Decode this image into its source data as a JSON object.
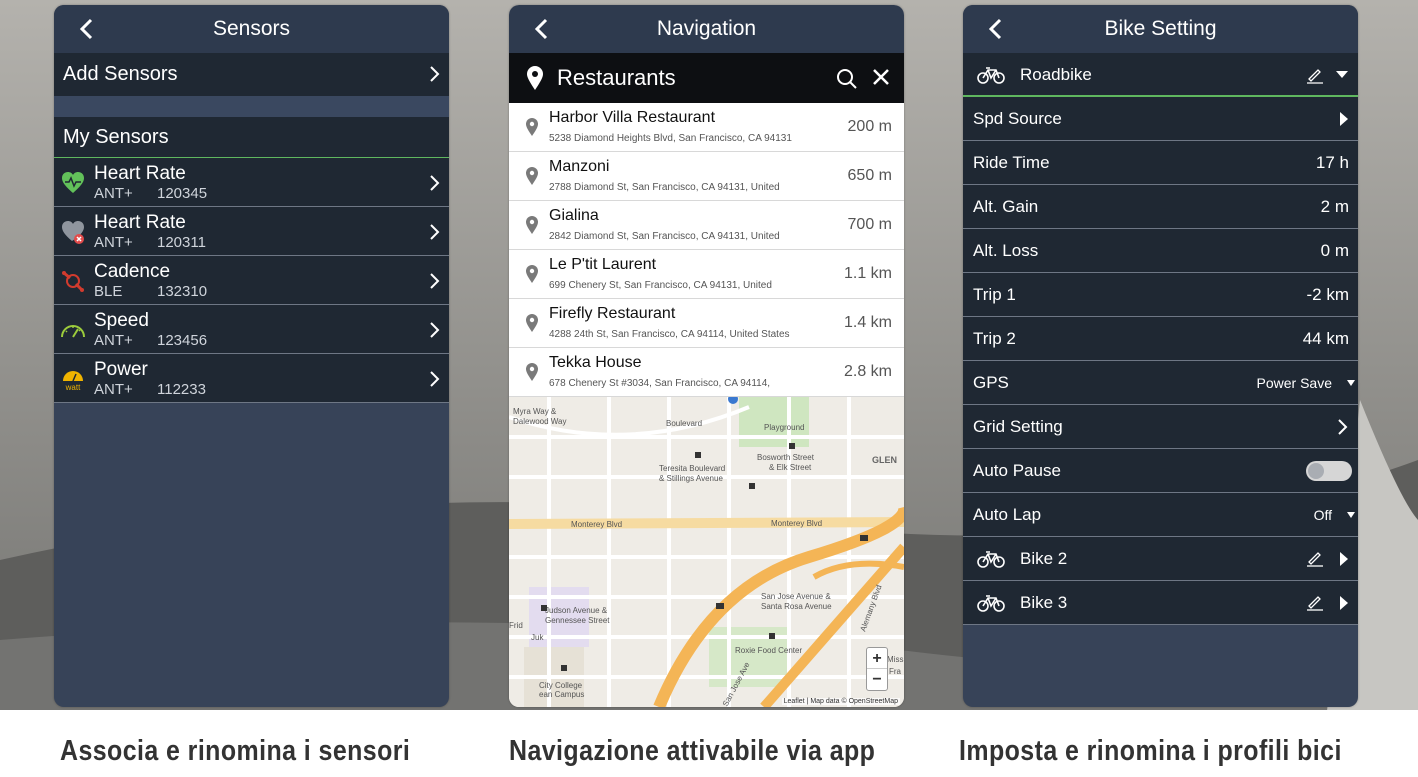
{
  "colors": {
    "panel_bg": "#374358",
    "row_bg": "#1f2833",
    "header_bg": "#2e3a4e",
    "accent_green": "#5fb75f",
    "heart_green": "#62c15a",
    "cadence_red": "#d23b2e",
    "speed_green": "#9ccc3c",
    "power_yellow": "#f0b400",
    "route_orange": "#f4b556"
  },
  "sensors_screen": {
    "title": "Sensors",
    "add_label": "Add Sensors",
    "section_label": "My Sensors",
    "items": [
      {
        "name": "Heart Rate",
        "protocol": "ANT+",
        "id": "120345",
        "icon": "heart-icon"
      },
      {
        "name": "Heart Rate",
        "protocol": "ANT+",
        "id": "120311",
        "icon": "heart-disconnected-icon"
      },
      {
        "name": "Cadence",
        "protocol": "BLE",
        "id": "132310",
        "icon": "cadence-icon"
      },
      {
        "name": "Speed",
        "protocol": "ANT+",
        "id": "123456",
        "icon": "speedometer-icon"
      },
      {
        "name": "Power",
        "protocol": "ANT+",
        "id": "112233",
        "icon": "power-watt-icon"
      }
    ]
  },
  "navigation_screen": {
    "title": "Navigation",
    "search_query": "Restaurants",
    "results": [
      {
        "name": "Harbor Villa Restaurant",
        "address": "5238 Diamond Heights Blvd, San Francisco, CA 94131",
        "distance": "200 m"
      },
      {
        "name": "Manzoni",
        "address": "2788 Diamond St, San Francisco, CA 94131, United",
        "distance": "650 m"
      },
      {
        "name": "Gialina",
        "address": "2842 Diamond St, San Francisco, CA 94131, United",
        "distance": "700 m"
      },
      {
        "name": "Le P'tit Laurent",
        "address": "699 Chenery St, San Francisco, CA 94131, United",
        "distance": "1.1 km"
      },
      {
        "name": "Firefly Restaurant",
        "address": "4288 24th St, San Francisco, CA 94114, United States",
        "distance": "1.4 km"
      },
      {
        "name": "Tekka House",
        "address": "678 Chenery St #3034, San Francisco, CA 94114,",
        "distance": "2.8 km"
      }
    ],
    "map_labels": {
      "myra": "Myra Way &",
      "dalewood": "Dalewood Way",
      "boulevard": "Boulevard",
      "playground": "Playground",
      "teresita": "Teresita Boulevard",
      "stillings": "& Stillings Avenue",
      "bosworth": "Bosworth Street",
      "elk": "& Elk Street",
      "glen": "GLEN",
      "monterey1": "Monterey Blvd",
      "monterey2": "Monterey Blvd",
      "sanjose": "San Jose Avenue &",
      "santarosa": "Santa Rosa Avenue",
      "judson": "Judson Avenue &",
      "gennessee": "Gennessee Street",
      "roxie": "Roxie Food Center",
      "city": "City College",
      "campus": "ean Campus",
      "frid": "Frid",
      "juk": "Juk",
      "missi": "Missi",
      "fra": "Fra",
      "alemany": "Alemany Blvd",
      "san": "San Jose Ave"
    },
    "zoom_in": "+",
    "zoom_out": "−",
    "attribution": "Leaflet | Map data © OpenStreetMap"
  },
  "bike_screen": {
    "title": "Bike Setting",
    "profile": "Roadbike",
    "rows": [
      {
        "label": "Spd Source",
        "value": "",
        "kind": "arrow"
      },
      {
        "label": "Ride Time",
        "value": "17 h",
        "kind": "value"
      },
      {
        "label": "Alt. Gain",
        "value": "2 m",
        "kind": "value"
      },
      {
        "label": "Alt. Loss",
        "value": "0 m",
        "kind": "value"
      },
      {
        "label": "Trip 1",
        "value": "-2 km",
        "kind": "value"
      },
      {
        "label": "Trip 2",
        "value": "44 km",
        "kind": "value"
      },
      {
        "label": "GPS",
        "value": "Power Save",
        "kind": "dropdown"
      },
      {
        "label": "Grid Setting",
        "value": "",
        "kind": "chevron"
      },
      {
        "label": "Auto Pause",
        "value": "",
        "kind": "toggle",
        "on": false
      },
      {
        "label": "Auto Lap",
        "value": "Off",
        "kind": "dropdown"
      }
    ],
    "other_bikes": [
      "Bike 2",
      "Bike 3"
    ]
  },
  "captions": {
    "sensors": "Associa e rinomina i sensori",
    "navigation": "Navigazione attivabile via app",
    "bike": "Imposta e rinomina i profili bici"
  }
}
